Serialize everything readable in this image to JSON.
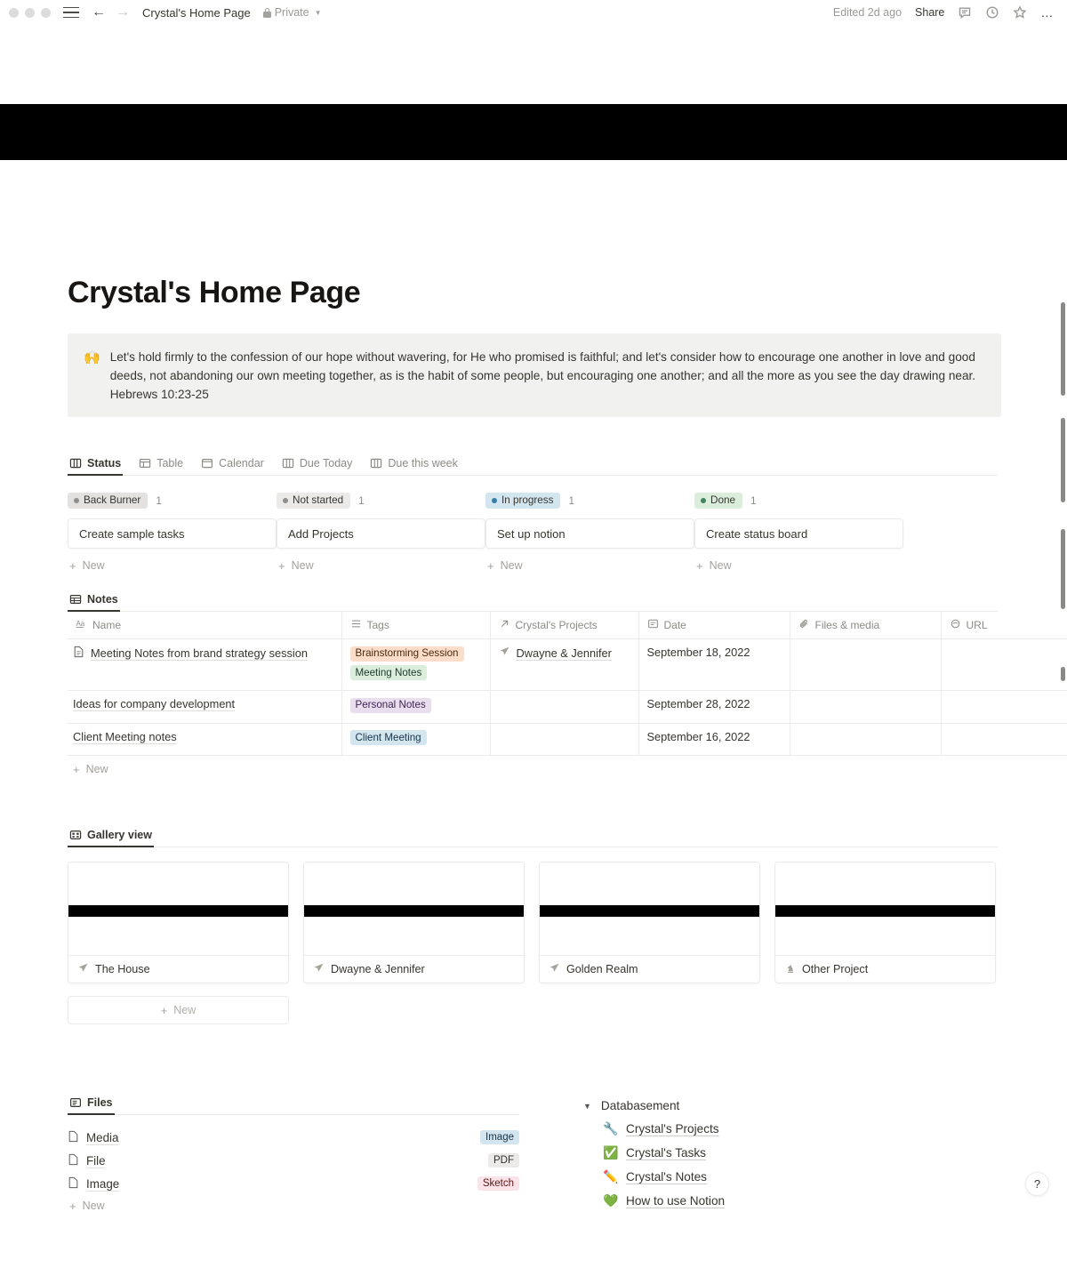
{
  "window": {
    "breadcrumb": "Crystal's Home Page",
    "privacy_label": "Private",
    "lock_icon": "lock-icon",
    "back_icon": "arrow-left-icon",
    "forward_icon": "arrow-right-icon",
    "menu_icon": "hamburger-menu-icon",
    "edited_label": "Edited 2d ago",
    "share_label": "Share",
    "comment_icon": "comment-icon",
    "history_icon": "clock-icon",
    "favorite_icon": "star-icon",
    "more_icon": "ellipsis-icon"
  },
  "page": {
    "title": "Crystal's Home Page",
    "callout": {
      "emoji": "🙌",
      "text": "Let's hold firmly to the confession of our hope without wavering, for He who promised is faithful; and let's consider how to encourage one another in love and good deeds, not abandoning our own meeting together, as is the habit of some people, but encouraging one another; and all the more as you see the day drawing near.",
      "reference": "Hebrews 10:23-25"
    }
  },
  "tasks_db": {
    "tabs": [
      {
        "label": "Status",
        "icon": "board-view-icon",
        "active": true
      },
      {
        "label": "Table",
        "icon": "table-view-icon",
        "active": false
      },
      {
        "label": "Calendar",
        "icon": "calendar-view-icon",
        "active": false
      },
      {
        "label": "Due Today",
        "icon": "board-view-icon",
        "active": false
      },
      {
        "label": "Due this week",
        "icon": "board-view-icon",
        "active": false
      }
    ],
    "columns": [
      {
        "name": "Back Burner",
        "count": "1",
        "chip_bg": "#e3e2e0",
        "dot": "#918f8b",
        "new_label": "New",
        "cards": [
          {
            "title": "Create sample tasks"
          }
        ]
      },
      {
        "name": "Not started",
        "count": "1",
        "chip_bg": "#ebeae8",
        "dot": "#918f8b",
        "new_label": "New",
        "cards": [
          {
            "title": "Add Projects"
          }
        ]
      },
      {
        "name": "In progress",
        "count": "1",
        "chip_bg": "#d3e5ef",
        "dot": "#337ea9",
        "new_label": "New",
        "cards": [
          {
            "title": "Set up notion"
          }
        ]
      },
      {
        "name": "Done",
        "count": "1",
        "chip_bg": "#dbeddb",
        "dot": "#448361",
        "new_label": "New",
        "cards": [
          {
            "title": "Create status board"
          }
        ]
      }
    ]
  },
  "notes_db": {
    "tab_label": "Notes",
    "tab_icon": "table-view-icon",
    "headers": [
      {
        "label": "Name",
        "icon": "text-property-icon"
      },
      {
        "label": "Tags",
        "icon": "multiselect-property-icon"
      },
      {
        "label": "Crystal's Projects",
        "icon": "relation-property-icon"
      },
      {
        "label": "Date",
        "icon": "date-property-icon"
      },
      {
        "label": "Files & media",
        "icon": "paperclip-property-icon"
      },
      {
        "label": "URL",
        "icon": "link-property-icon"
      }
    ],
    "rows": [
      {
        "name": "Meeting Notes from brand strategy session",
        "page_icon": "document-icon",
        "tags": [
          {
            "label": "Brainstorming Session",
            "bg": "#fadec9",
            "fg": "#49290f"
          },
          {
            "label": "Meeting Notes",
            "bg": "#dbeddb",
            "fg": "#1c3829"
          }
        ],
        "project": "Dwayne & Jennifer",
        "project_icon": "paper-plane-icon",
        "date": "September 18, 2022",
        "files": "",
        "url": ""
      },
      {
        "name": "Ideas for company development",
        "page_icon": "",
        "tags": [
          {
            "label": "Personal Notes",
            "bg": "#e8deee",
            "fg": "#412454"
          }
        ],
        "project": "",
        "project_icon": "",
        "date": "September 28, 2022",
        "files": "",
        "url": ""
      },
      {
        "name": "Client Meeting notes",
        "page_icon": "",
        "tags": [
          {
            "label": "Client Meeting",
            "bg": "#d3e5ef",
            "fg": "#183347"
          }
        ],
        "project": "",
        "project_icon": "",
        "date": "September 16, 2022",
        "files": "",
        "url": ""
      }
    ],
    "new_label": "New"
  },
  "gallery_db": {
    "tab_label": "Gallery view",
    "tab_icon": "gallery-view-icon",
    "cards": [
      {
        "title": "The House",
        "icon": "paper-plane-icon"
      },
      {
        "title": "Dwayne & Jennifer",
        "icon": "paper-plane-icon"
      },
      {
        "title": "Golden Realm",
        "icon": "paper-plane-icon"
      },
      {
        "title": "Other Project",
        "icon": "chess-knight-icon"
      }
    ],
    "new_label": "New"
  },
  "files_db": {
    "tab_label": "Files",
    "tab_icon": "list-view-icon",
    "rows": [
      {
        "name": "Media",
        "page_icon": "document-icon",
        "badge": "Image",
        "badge_bg": "#d3e5ef",
        "badge_fg": "#183347"
      },
      {
        "name": "File",
        "page_icon": "document-icon",
        "badge": "PDF",
        "badge_bg": "#ebeae8",
        "badge_fg": "#32302c"
      },
      {
        "name": "Image",
        "page_icon": "document-icon",
        "badge": "Sketch",
        "badge_bg": "#fbe4e9",
        "badge_fg": "#5d1715"
      }
    ],
    "new_label": "New"
  },
  "databasement": {
    "title": "Databasement",
    "toggle_icon": "triangle-down-icon",
    "items": [
      {
        "label": "Crystal's Projects",
        "emoji": "🔧"
      },
      {
        "label": "Crystal's Tasks",
        "emoji": "✅"
      },
      {
        "label": "Crystal's Notes",
        "emoji": "✏️"
      },
      {
        "label": "How to use Notion",
        "emoji": "💚"
      }
    ]
  },
  "help": {
    "label": "?"
  }
}
